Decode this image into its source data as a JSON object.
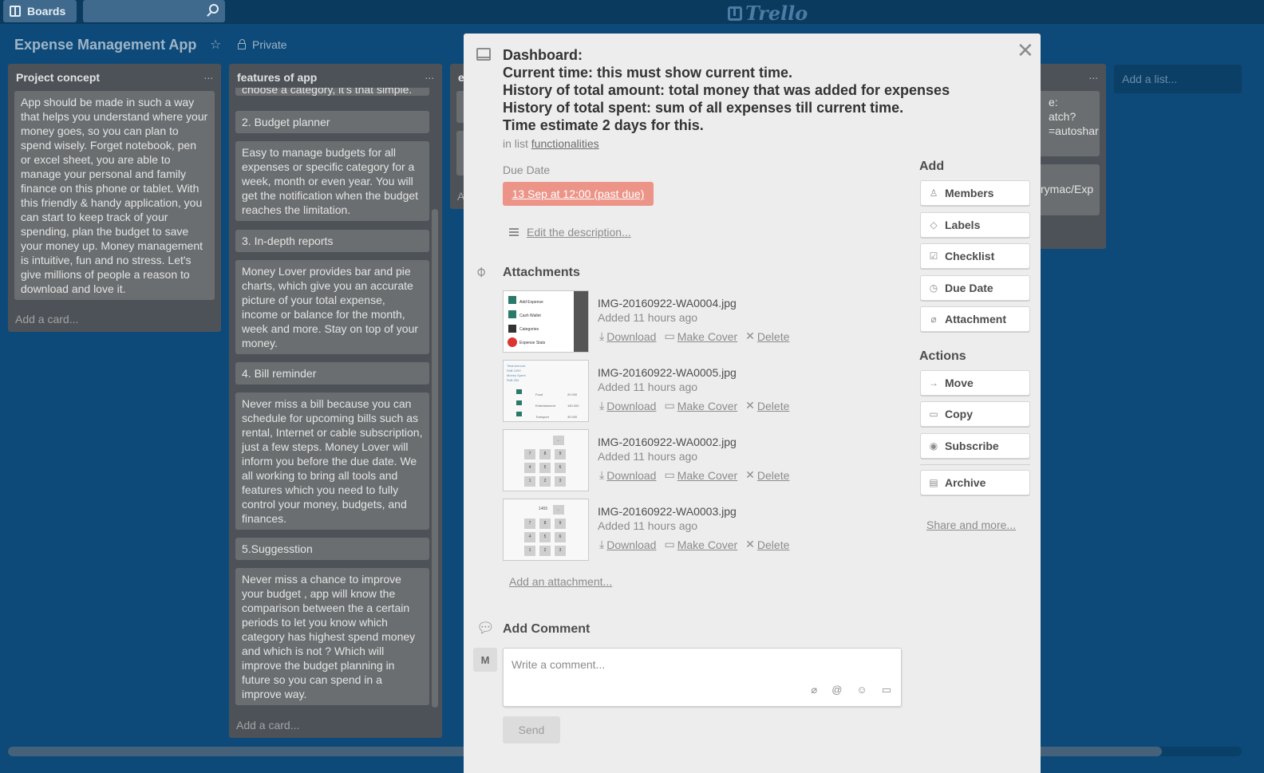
{
  "header": {
    "boards_label": "Boards",
    "logo_text": "Trello"
  },
  "board": {
    "title": "Expense Management App",
    "privacy": "Private",
    "add_list": "Add a list..."
  },
  "lists": {
    "concept": {
      "title": "Project concept",
      "menu": "...",
      "cards": [
        "App should be made in such a way that helps you understand where your money goes, so you can plan to spend wisely. Forget notebook, pen or excel sheet, you are able to manage your personal and family finance on this phone or tablet. With this friendly & handy application, you can start to keep track of your spending, plan the budget to save your money up. Money management is intuitive, fun and no stress. Let's give millions of people a reason to download and love it."
      ],
      "add_card": "Add a card..."
    },
    "features": {
      "title": "features of app",
      "menu": "...",
      "cards": [
        "choose a category, it's that simple.",
        "2. Budget planner",
        "Easy to manage budgets for all expenses or specific category for a week, month or even year. You will get the notification when the budget reaches the limitation.",
        "3. In-depth reports",
        "Money Lover provides bar and pie charts, which give you an accurate picture of your total expense, income or balance for the month, week and more. Stay on top of your money.",
        "4. Bill reminder",
        "Never miss a bill because you can schedule for upcoming bills such as rental, Internet or cable subscription, just a few steps. Money Lover will inform you before the due date. We all working to bring all tools and features which you need to fully control your money, budgets, and finances.",
        "5.Suggesstion",
        "Never miss a chance to improve your budget , app will know the comparison between the a certain periods to let you know which category has highest spend money and which is not ? Which will improve the budget planning in future so you can spend in a improve way."
      ],
      "add_card": "Add a card..."
    },
    "third": {
      "title_fragment": "e",
      "add_fragment": "A"
    },
    "right": {
      "menu": "...",
      "card1_fragment": "e:\natch?\n=autoshar",
      "card2_fragment": "rymac/Exp"
    }
  },
  "modal": {
    "title_lines": [
      "Dashboard:",
      "Current time: this must show current time.",
      "History of total amount: total money that was added for expenses",
      "History of total spent: sum of all expenses till current time.",
      "Time estimate 2 days for this."
    ],
    "in_list_prefix": "in list",
    "in_list_name": "functionalities",
    "due_label": "Due Date",
    "due_value": "13 Sep at 12:00 (past due)",
    "edit_description": "Edit the description...",
    "attachments_title": "Attachments",
    "attachments": [
      {
        "name": "IMG-20160922-WA0004.jpg",
        "time": "Added 11 hours ago",
        "thumb": "menu"
      },
      {
        "name": "IMG-20160922-WA0005.jpg",
        "time": "Added 11 hours ago",
        "thumb": "list"
      },
      {
        "name": "IMG-20160922-WA0002.jpg",
        "time": "Added 11 hours ago",
        "thumb": "keypad"
      },
      {
        "name": "IMG-20160922-WA0003.jpg",
        "time": "Added 11 hours ago",
        "thumb": "keypad2"
      }
    ],
    "action_download": "Download",
    "action_cover": "Make Cover",
    "action_delete": "Delete",
    "add_attachment": "Add an attachment...",
    "comment_title": "Add Comment",
    "avatar_initial": "M",
    "comment_placeholder": "Write a comment...",
    "send_label": "Send"
  },
  "sidebar": {
    "add_heading": "Add",
    "add_buttons": [
      "Members",
      "Labels",
      "Checklist",
      "Due Date",
      "Attachment"
    ],
    "actions_heading": "Actions",
    "action_buttons": [
      "Move",
      "Copy",
      "Subscribe"
    ],
    "archive_label": "Archive",
    "share_more": "Share and more..."
  },
  "thumbs": {
    "menu_items": [
      "Add Expense",
      "Cash Wallet",
      "Categories",
      "Expense Stats"
    ],
    "list_top": [
      "Total Amount",
      "RsB 1000",
      "Money Spent",
      "RsB 250"
    ],
    "list_rows": [
      [
        "Food",
        "20 000"
      ],
      [
        "Entertainment",
        "150 000"
      ],
      [
        "Transport",
        "30 000"
      ]
    ],
    "keypad_keys": [
      "7",
      "8",
      "9",
      "4",
      "5",
      "6",
      "1",
      "2",
      "3"
    ],
    "keypad_back": "←",
    "keypad_value": "1465"
  },
  "colors": {
    "background": "#0d4a79",
    "due_badge": "#ec9488",
    "modal": "#ededed"
  }
}
